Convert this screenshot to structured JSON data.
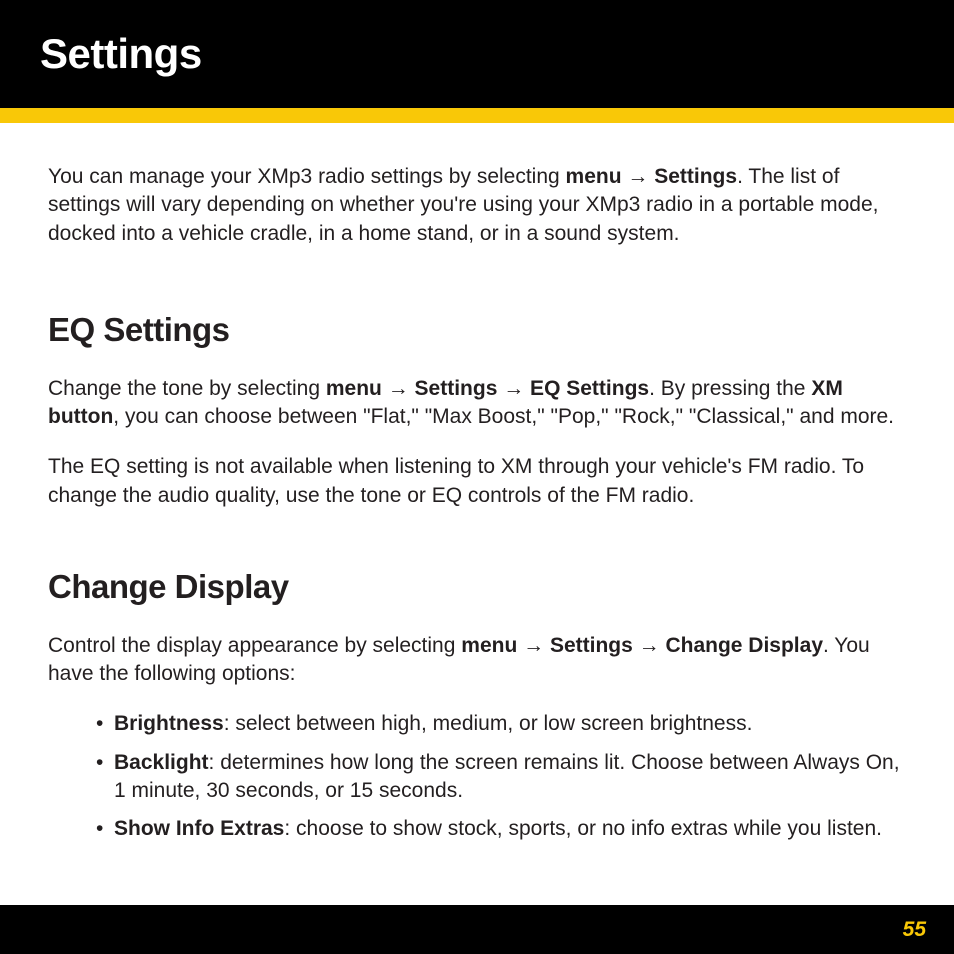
{
  "header": {
    "title": "Settings"
  },
  "intro": {
    "pre": "You can manage your XMp3 radio settings by selecting ",
    "bold1": "menu → Settings",
    "post": ". The list of settings will vary depending on whether you're using your XMp3 radio in a portable mode, docked into a vehicle cradle, in a home stand, or in a sound system."
  },
  "eq": {
    "heading": "EQ Settings",
    "p1_a": "Change the tone by selecting ",
    "p1_b": "menu → Settings → EQ Settings",
    "p1_c": ". By pressing the ",
    "p1_d": "XM button",
    "p1_e": ", you can choose between \"Flat,\" \"Max Boost,\" \"Pop,\" \"Rock,\" \"Classical,\" and more.",
    "p2": "The EQ setting is not available when listening to XM through your vehicle's FM radio. To change the audio quality, use the tone or EQ controls of the FM radio."
  },
  "display": {
    "heading": "Change Display",
    "p1_a": "Control the display appearance by selecting ",
    "p1_b": "menu → Settings → Change Display",
    "p1_c": ". You have the following options:",
    "bullets": [
      {
        "label": "Brightness",
        "desc": ": select between high, medium, or low screen brightness."
      },
      {
        "label": "Backlight",
        "desc": ": determines how long the screen remains lit. Choose between Always On, 1 minute, 30 seconds, or 15 seconds."
      },
      {
        "label": "Show Info Extras",
        "desc": ": choose to show stock, sports, or no info extras while you listen."
      }
    ]
  },
  "footer": {
    "page_number": "55"
  }
}
